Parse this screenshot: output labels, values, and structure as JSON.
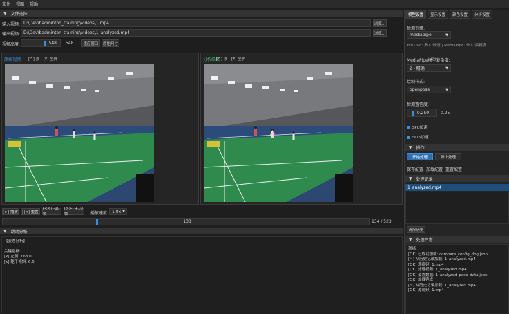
{
  "menu": [
    "文件",
    "视图",
    "帮助"
  ],
  "file_section": {
    "title": "文件选择",
    "input_label": "输入视频:",
    "input_value": "D:\\Dev\\badminton_training\\videos\\1.mp4",
    "output_label": "输出视频:",
    "output_value": "D:\\Dev\\badminton_training\\videos\\1_analyzed.mp4",
    "browse1": "浏览...",
    "browse2": "浏览...",
    "height_label": "视频高度:",
    "height_value": "548",
    "height_value2": "548",
    "fit_button": "适应窗口",
    "reset_button": "原始尺寸"
  },
  "video_left": {
    "title": "原始视频",
    "cb1": "[^] 顶",
    "cb2": "[F] 全屏"
  },
  "video_right": {
    "title": "分析结果",
    "cb1": "[^] 顶",
    "cb2": "[F] 全屏"
  },
  "controls": {
    "play": "[>] 播放",
    "reset": "[|<] 重置",
    "back": "[<<] -10帧",
    "fwd": "[>>] +10帧",
    "speed_label": "播放速度:",
    "speed_value": "1.0x",
    "frame_current": "133",
    "frame_total": "134 / 523",
    "progress": 0.254
  },
  "analysis": {
    "title": "跳动分析",
    "sub": "【姿态分析】",
    "line1": "关键指标:",
    "line2": "[x] 左腿: 168.0",
    "line3": "[x] 躯干倾斜: 6.6"
  },
  "right_tabs": [
    "模型设置",
    "显示设置",
    "颜色设置",
    "分析设置"
  ],
  "model": {
    "engine_label": "检测引擎:",
    "engine_value": "mediapipe",
    "engine_hint": "YOLOv8: 多人/快速 | MediaPipe: 单人/高精度",
    "quality_label": "MediaPipe模型复杂度:",
    "quality_value": "2 - 精确",
    "style_label": "绘制样式:",
    "style_value": "openpose",
    "conf_label": "检测置信度:",
    "conf_value": "0.250",
    "conf_value2": "0.25",
    "gpu_label": "GPU加速",
    "fp16_label": "FP16加速"
  },
  "ops": {
    "title": "操作",
    "start": "开始处理",
    "stop": "停止处理",
    "link1": "保存配置",
    "link2": "加载配置",
    "link3": "重置配置"
  },
  "history": {
    "title": "处理记录",
    "item": "1_analyzed.mp4",
    "clear": "清除历史"
  },
  "log": {
    "title": "处理日志",
    "lines": [
      "就绪",
      "[OK] 已成功加载: compare_config_dpg.json",
      "[~] 从历史记录加载: 1_analyzed.mp4",
      "  [OK] 源视频: 1.mp4",
      "  [OK] 处理视频: 1_analyzed.mp4",
      "  [OK] 姿态数据: 1_analyzed_pose_data.json",
      "[OK] 加载完成",
      "[~] 从历史记录加载: 1_analyzed.mp4",
      "  [OK] 源视频: 1.mp4"
    ]
  },
  "colors": {
    "accent": "#3b8ede",
    "court": "#2f8a4e",
    "selected": "#1e4f7a"
  }
}
